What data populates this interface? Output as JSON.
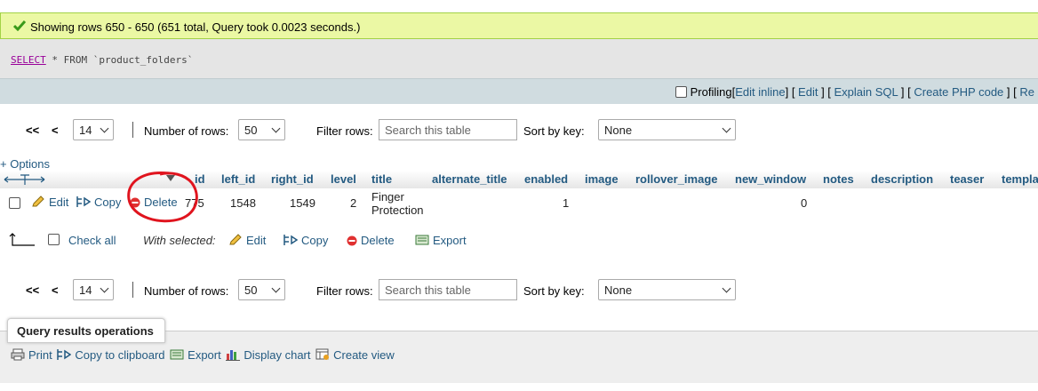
{
  "success": {
    "message": "Showing rows 650 - 650 (651 total, Query took 0.0023 seconds.)"
  },
  "query": {
    "keyword": "SELECT",
    "rest": " * FROM `product_folders`"
  },
  "profiling": {
    "label": "Profiling",
    "links": [
      "Edit inline",
      "Edit",
      "Explain SQL",
      "Create PHP code",
      "Re"
    ]
  },
  "nav_top": {
    "first": "<<",
    "prev": "<",
    "page": "14",
    "rows_label": "Number of rows:",
    "rows_value": "50",
    "filter_label": "Filter rows:",
    "filter_placeholder": "Search this table",
    "sort_label": "Sort by key:",
    "sort_value": "None"
  },
  "nav_bottom": {
    "first": "<<",
    "prev": "<",
    "page": "14",
    "rows_label": "Number of rows:",
    "rows_value": "50",
    "filter_label": "Filter rows:",
    "filter_placeholder": "Search this table",
    "sort_label": "Sort by key:",
    "sort_value": "None"
  },
  "options_label": "+ Options",
  "columns": [
    "id",
    "left_id",
    "right_id",
    "level",
    "title",
    "alternate_title",
    "enabled",
    "image",
    "rollover_image",
    "new_window",
    "notes",
    "description",
    "teaser",
    "templa"
  ],
  "row": {
    "edit": "Edit",
    "copy": "Copy",
    "delete": "Delete",
    "id": "775",
    "left_id": "1548",
    "right_id": "1549",
    "level": "2",
    "title_line1": "Finger",
    "title_line2": "Protection",
    "enabled": "1",
    "new_window": "0"
  },
  "selection": {
    "check_all": "Check all",
    "with_selected": "With selected:",
    "edit": "Edit",
    "copy": "Copy",
    "delete": "Delete",
    "export": "Export"
  },
  "operations": {
    "title": "Query results operations",
    "items": [
      "Print",
      "Copy to clipboard",
      "Export",
      "Display chart",
      "Create view"
    ]
  },
  "colors": {
    "success_bg": "#ebf8a4",
    "link": "#235a81",
    "delete_red": "#e03030",
    "annotation_red": "#e0141e"
  }
}
